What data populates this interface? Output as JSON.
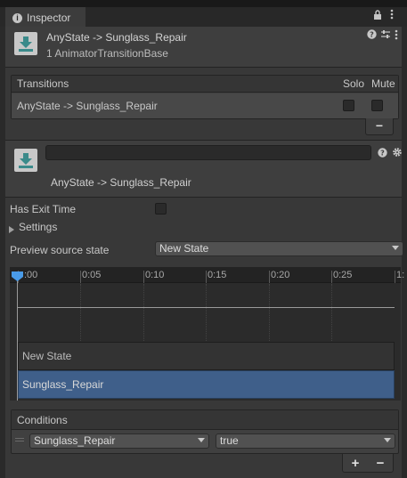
{
  "tab": {
    "icon": "info-icon",
    "title": "Inspector",
    "lock_icon": "lock-icon",
    "menu_icon": "kebab-menu-icon"
  },
  "header": {
    "icon": "animator-transition-icon",
    "title": "AnyState -> Sunglass_Repair",
    "subtitle": "1 AnimatorTransitionBase",
    "help_icon": "help-icon",
    "preset_icon": "preset-sliders-icon",
    "menu_icon": "kebab-menu-icon"
  },
  "transitions": {
    "header": "Transitions",
    "solo_label": "Solo",
    "mute_label": "Mute",
    "rows": [
      {
        "label": "AnyState -> Sunglass_Repair",
        "solo": false,
        "mute": false
      }
    ],
    "remove_label": "−"
  },
  "transition": {
    "icon": "animator-transition-icon",
    "name_value": "",
    "label": "AnyState -> Sunglass_Repair",
    "help_icon": "help-icon",
    "settings_icon": "gear-icon"
  },
  "properties": {
    "has_exit_time_label": "Has Exit Time",
    "has_exit_time": false,
    "settings_label": "Settings",
    "preview_label": "Preview source state",
    "preview_value": "New State"
  },
  "timeline": {
    "ticks": [
      ":00",
      "0:05",
      "0:10",
      "0:15",
      "0:20",
      "0:25",
      "1:"
    ],
    "states": [
      {
        "label": "New State",
        "color": "#333333"
      },
      {
        "label": "Sunglass_Repair",
        "color": "#3f5f8a"
      }
    ],
    "cursor_color": "#4a9be8"
  },
  "conditions": {
    "header": "Conditions",
    "items": [
      {
        "parameter": "Sunglass_Repair",
        "value": "true"
      }
    ],
    "add_label": "+",
    "remove_label": "−"
  }
}
